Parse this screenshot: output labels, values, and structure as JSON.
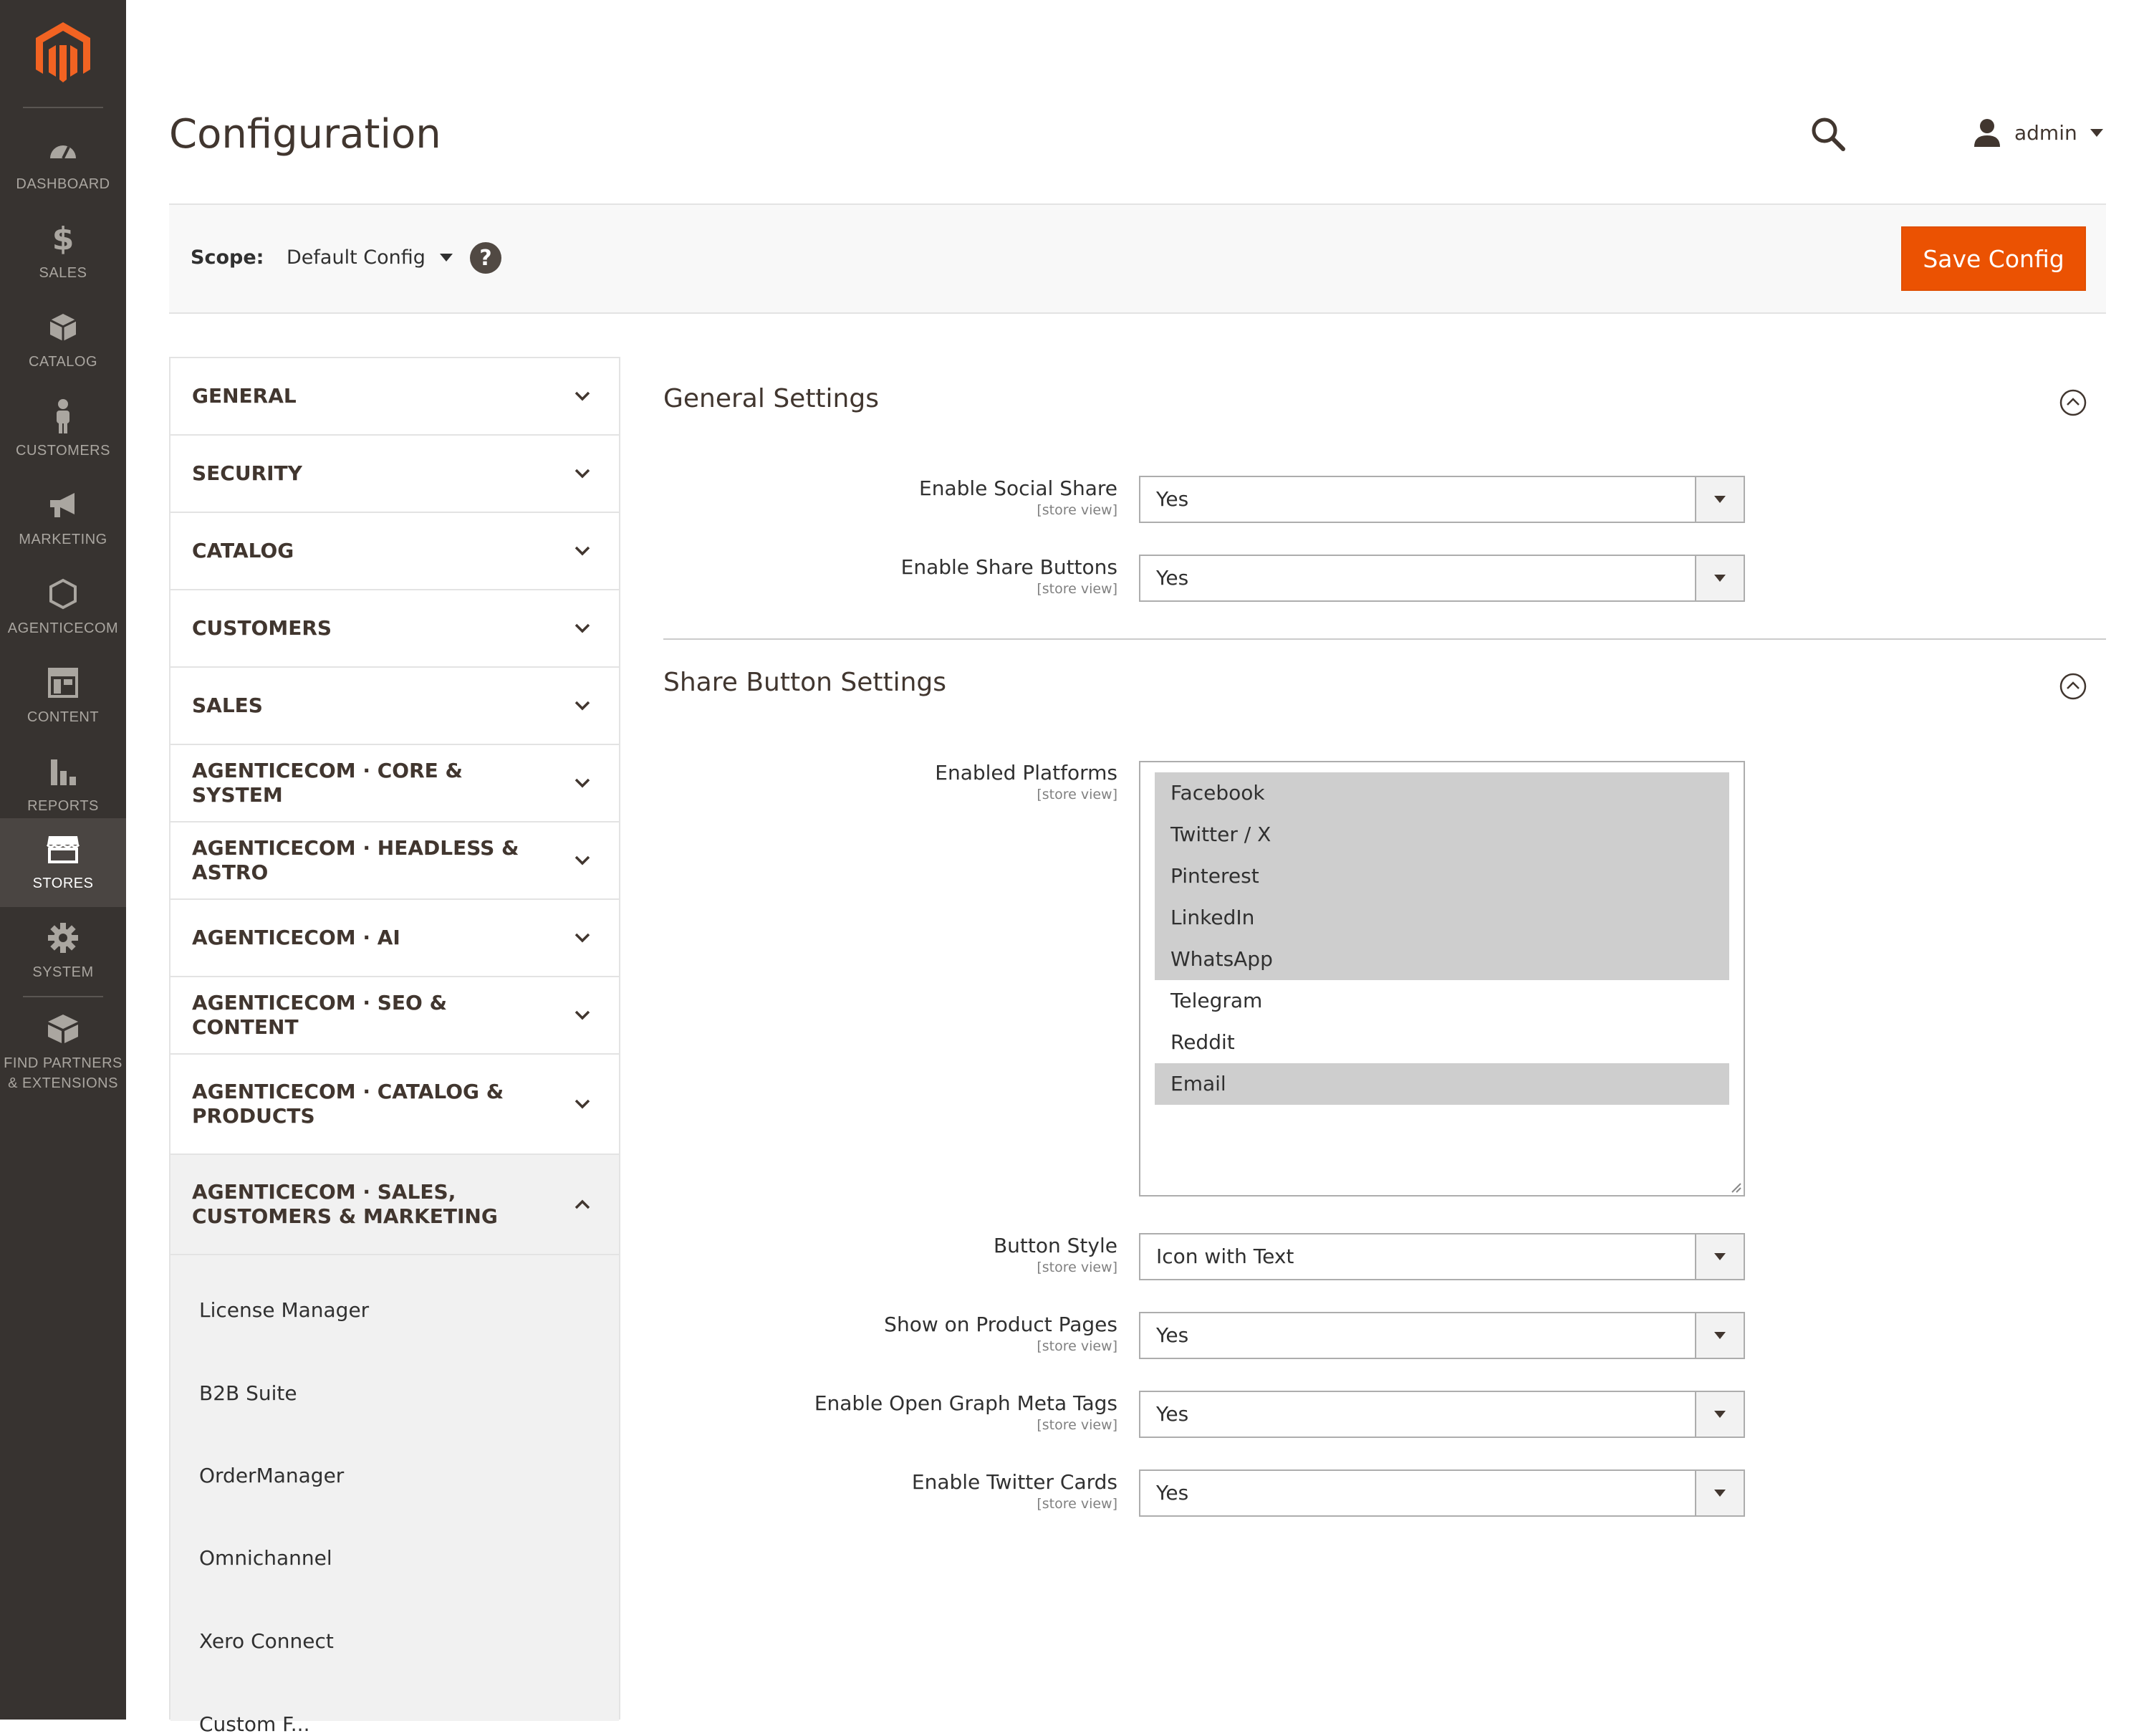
{
  "sidebar": {
    "items": [
      {
        "label": "DASHBOARD",
        "icon": "dashboard-icon"
      },
      {
        "label": "SALES",
        "icon": "dollar-icon"
      },
      {
        "label": "CATALOG",
        "icon": "box-icon"
      },
      {
        "label": "CUSTOMERS",
        "icon": "person-icon"
      },
      {
        "label": "MARKETING",
        "icon": "megaphone-icon"
      },
      {
        "label": "AGENTICECOM",
        "icon": "hexagon-icon"
      },
      {
        "label": "CONTENT",
        "icon": "layout-icon"
      },
      {
        "label": "REPORTS",
        "icon": "bar-chart-icon"
      },
      {
        "label": "STORES",
        "icon": "store-icon"
      },
      {
        "label": "SYSTEM",
        "icon": "gear-icon"
      },
      {
        "label": "FIND PARTNERS & EXTENSIONS",
        "icon": "extensions-icon"
      }
    ],
    "active": "STORES"
  },
  "header": {
    "title": "Configuration",
    "user": "admin"
  },
  "scope": {
    "label": "Scope:",
    "value": "Default Config",
    "help": "?",
    "save_label": "Save Config"
  },
  "tabs": {
    "items": [
      {
        "label": "GENERAL"
      },
      {
        "label": "SECURITY"
      },
      {
        "label": "CATALOG"
      },
      {
        "label": "CUSTOMERS"
      },
      {
        "label": "SALES"
      },
      {
        "label": "AGENTICECOM · CORE & SYSTEM"
      },
      {
        "label": "AGENTICECOM · HEADLESS & ASTRO"
      },
      {
        "label": "AGENTICECOM · AI"
      },
      {
        "label": "AGENTICECOM · SEO & CONTENT"
      },
      {
        "label": "AGENTICECOM · CATALOG & PRODUCTS"
      },
      {
        "label": "AGENTICECOM · SALES, CUSTOMERS & MARKETING"
      }
    ],
    "subitems": [
      {
        "label": "License Manager"
      },
      {
        "label": "B2B Suite"
      },
      {
        "label": "OrderManager"
      },
      {
        "label": "Omnichannel"
      },
      {
        "label": "Xero Connect"
      },
      {
        "label": "Custom F..."
      }
    ]
  },
  "general_settings": {
    "title": "General Settings",
    "fields": [
      {
        "label": "Enable Social Share",
        "scope": "[store view]",
        "value": "Yes"
      },
      {
        "label": "Enable Share Buttons",
        "scope": "[store view]",
        "value": "Yes"
      }
    ]
  },
  "share_settings": {
    "title": "Share Button Settings",
    "platforms": {
      "label": "Enabled Platforms",
      "scope": "[store view]",
      "options": [
        {
          "label": "Facebook",
          "selected": true
        },
        {
          "label": "Twitter / X",
          "selected": true
        },
        {
          "label": "Pinterest",
          "selected": true
        },
        {
          "label": "LinkedIn",
          "selected": true
        },
        {
          "label": "WhatsApp",
          "selected": true
        },
        {
          "label": "Telegram",
          "selected": false
        },
        {
          "label": "Reddit",
          "selected": false
        },
        {
          "label": "Email",
          "selected": true
        }
      ]
    },
    "fields": [
      {
        "label": "Button Style",
        "scope": "[store view]",
        "value": "Icon with Text"
      },
      {
        "label": "Show on Product Pages",
        "scope": "[store view]",
        "value": "Yes"
      },
      {
        "label": "Enable Open Graph Meta Tags",
        "scope": "[store view]",
        "value": "Yes"
      },
      {
        "label": "Enable Twitter Cards",
        "scope": "[store view]",
        "value": "Yes"
      }
    ]
  },
  "colors": {
    "sidebar_bg": "#373330",
    "accent": "#eb5202",
    "selected_option": "#cecece"
  }
}
